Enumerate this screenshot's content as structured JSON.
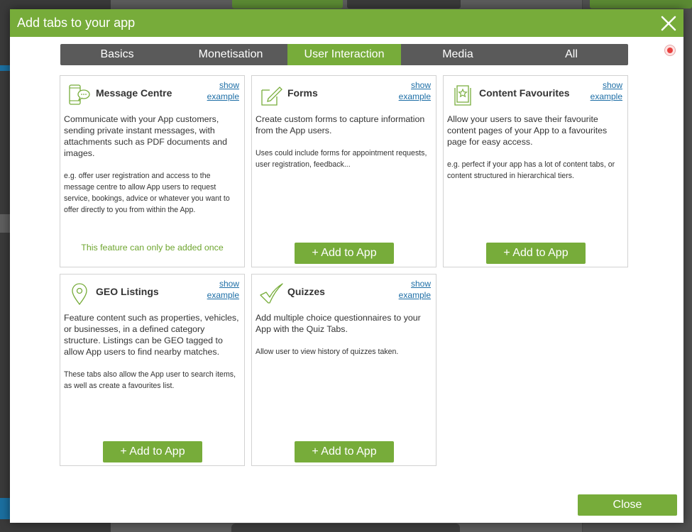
{
  "modal": {
    "title": "Add tabs to your app",
    "close_label": "Close"
  },
  "tabs": [
    {
      "label": "Basics"
    },
    {
      "label": "Monetisation"
    },
    {
      "label": "User Interaction",
      "active": true
    },
    {
      "label": "Media"
    },
    {
      "label": "All"
    }
  ],
  "show_example": {
    "line1": "show",
    "line2": "example"
  },
  "cards": [
    {
      "title": "Message Centre",
      "icon": "phone-chat-icon",
      "description": "Communicate with your App customers, sending private instant messages, with attachments such as PDF documents and images.",
      "note": "e.g. offer user registration and access to the message centre to allow App users to request service, bookings, advice or whatever you want to offer directly to you from within the App.",
      "footer_text": "This feature can only be added once"
    },
    {
      "title": "Forms",
      "icon": "form-pen-icon",
      "description": "Create custom forms to capture information from the App users.",
      "note": "Uses could include forms for appointment requests, user registration, feedback...",
      "button_label": "+ Add to App"
    },
    {
      "title": "Content Favourites",
      "icon": "favourites-book-icon",
      "description": "Allow your users to save their favourite content pages of your App to a favourites page for easy access.",
      "note": "e.g. perfect if your app has a lot of content tabs, or content structured in hierarchical tiers.",
      "button_label": "+ Add to App"
    },
    {
      "title": "GEO Listings",
      "icon": "location-pin-icon",
      "description": "Feature content such as properties, vehicles, or businesses, in a defined category structure. Listings can be GEO tagged to allow App users to find nearby matches.",
      "note": "These tabs also allow the App user to search items, as well as create a favourites list.",
      "button_label": "+ Add to App"
    },
    {
      "title": "Quizzes",
      "icon": "checkmark-icon",
      "description": "Add multiple choice questionnaires to your App with the Quiz Tabs.",
      "note": "Allow user to view history of quizzes taken.",
      "button_label": "+ Add to App"
    }
  ],
  "colors": {
    "accent_green": "#77ac3a",
    "tab_bar_gray": "#5a5a5a",
    "link_blue": "#1d6ea6"
  }
}
